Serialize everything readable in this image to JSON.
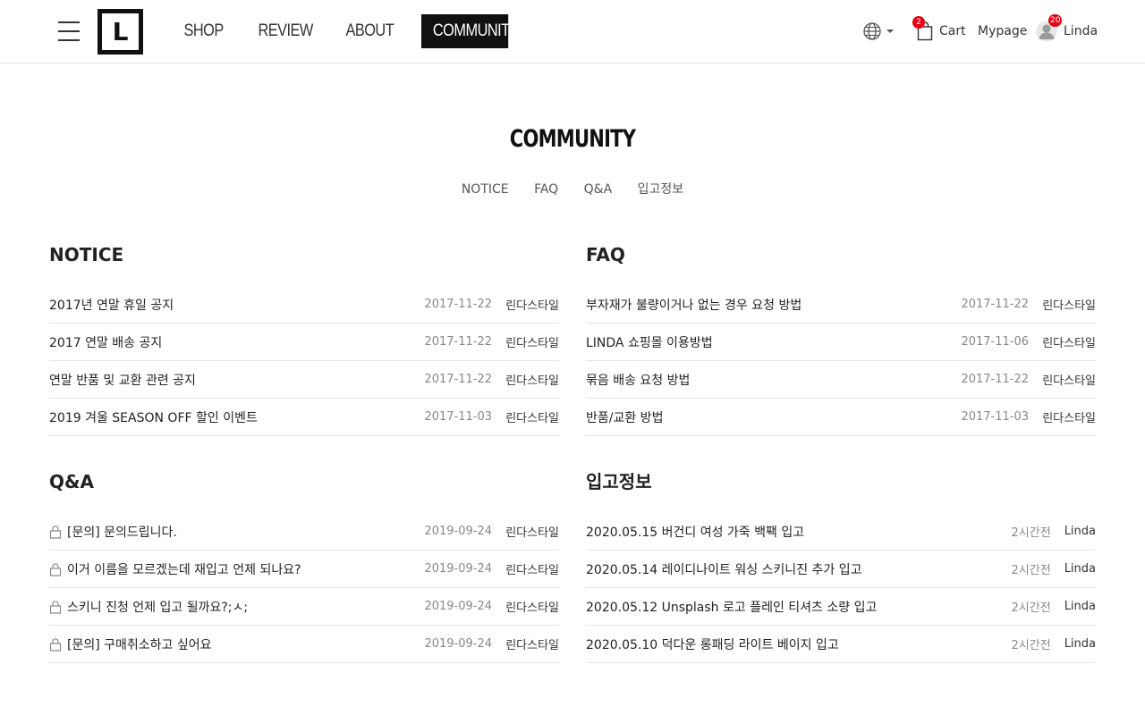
{
  "header": {
    "logo_letter": "L",
    "nav": [
      "SHOP",
      "REVIEW",
      "ABOUT",
      "COMMUNITY"
    ],
    "cart_label": "Cart",
    "cart_count": "2",
    "mypage_label": "Mypage",
    "user_name": "Linda",
    "user_badge": "20"
  },
  "page": {
    "title": "COMMUNITY",
    "subnav": [
      "NOTICE",
      "FAQ",
      "Q&A",
      "입고정보"
    ]
  },
  "boards": {
    "notice": {
      "title": "NOTICE",
      "rows": [
        {
          "title": "2017년 연말 휴일 공지",
          "date": "2017-11-22",
          "author": "린다스타일"
        },
        {
          "title": "2017 연말 배송 공지",
          "date": "2017-11-22",
          "author": "린다스타일"
        },
        {
          "title": "연말 반품 및 교환 관련 공지",
          "date": "2017-11-22",
          "author": "린다스타일"
        },
        {
          "title": "2019 겨울 SEASON OFF 할인 이벤트",
          "date": "2017-11-03",
          "author": "린다스타일"
        }
      ]
    },
    "faq": {
      "title": "FAQ",
      "rows": [
        {
          "title": "부자재가 불량이거나 없는 경우 요청 방법",
          "date": "2017-11-22",
          "author": "린다스타일"
        },
        {
          "title": "LINDA 쇼핑몰 이용방법",
          "date": "2017-11-06",
          "author": "린다스타일"
        },
        {
          "title": "묶음 배송 요청 방법",
          "date": "2017-11-22",
          "author": "린다스타일"
        },
        {
          "title": "반품/교환 방법",
          "date": "2017-11-03",
          "author": "린다스타일"
        }
      ]
    },
    "qna": {
      "title": "Q&A",
      "rows": [
        {
          "title": "[문의] 문의드립니다.",
          "date": "2019-09-24",
          "author": "린다스타일"
        },
        {
          "title": "이거 이름을 모르겠는데 재입고 언제 되나요?",
          "date": "2019-09-24",
          "author": "린다스타일"
        },
        {
          "title": "스키니 진청 언제 입고 될까요?;ㅅ;",
          "date": "2019-09-24",
          "author": "린다스타일"
        },
        {
          "title": "[문의] 구매취소하고 싶어요",
          "date": "2019-09-24",
          "author": "린다스타일"
        }
      ]
    },
    "restock": {
      "title": "입고정보",
      "rows": [
        {
          "title": "2020.05.15 버건디 여성 가죽 백팩 입고",
          "date": "2시간전",
          "author": "Linda"
        },
        {
          "title": "2020.05.14 레이디나이트 워싱 스키니진 추가 입고",
          "date": "2시간전",
          "author": "Linda"
        },
        {
          "title": "2020.05.12 Unsplash 로고 플레인 티셔츠 소량 입고",
          "date": "2시간전",
          "author": "Linda"
        },
        {
          "title": "2020.05.10 덕다운 롱패딩 라이트 베이지 입고",
          "date": "2시간전",
          "author": "Linda"
        }
      ]
    }
  }
}
